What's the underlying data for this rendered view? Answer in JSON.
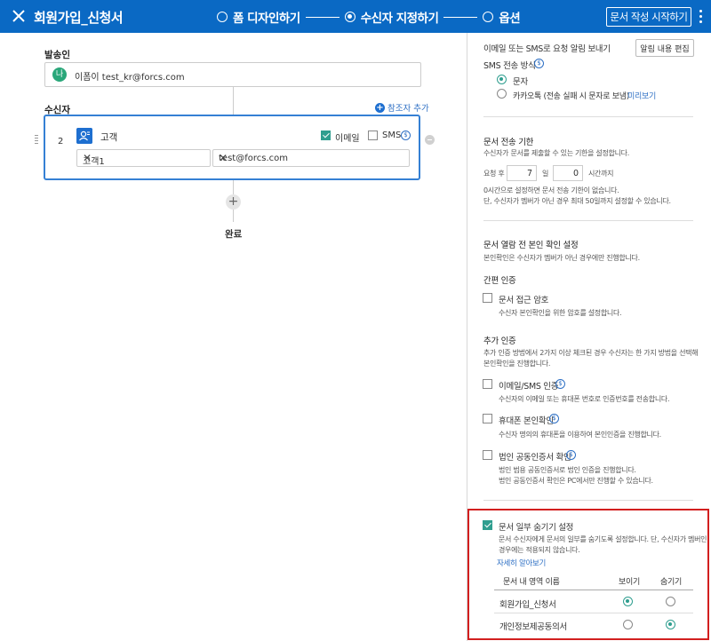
{
  "header": {
    "title": "회원가입_신청서",
    "steps": [
      "폼 디자인하기",
      "수신자 지정하기",
      "옵션"
    ],
    "active_step": 1,
    "start_button": "문서 작성 시작하기"
  },
  "sender": {
    "label": "발송인",
    "avatar": "나",
    "name": "이폼이 test_kr@forcs.com"
  },
  "recipients": {
    "label": "수신자",
    "add_ref": "참조자 추가",
    "items": [
      {
        "number": "2",
        "name": "고객",
        "email_checked": true,
        "email_label": "이메일",
        "sms_checked": false,
        "sms_label": "SMS",
        "name_value": "고객1",
        "email_value": "test@forcs.com"
      }
    ],
    "done": "완료"
  },
  "options": {
    "notify_text": "이메일 또는 SMS로 요청 알림 보내기",
    "edit_notify_button": "알림 내용 편집",
    "sms_method_label": "SMS 전송 방식",
    "sms_methods": [
      "문자",
      "카카오톡 (전송 실패 시 문자로 보냄)"
    ],
    "sms_selected": 0,
    "preview_link": "미리보기",
    "deadline": {
      "title": "문서 전송 기한",
      "desc": "수신자가 문서를 제출할 수 있는 기한을 설정합니다.",
      "prefix": "요청 후",
      "days": "7",
      "day_unit": "일",
      "hours": "0",
      "hour_unit": "시간까지",
      "note1": "0시간으로 설정하면 문서 전송 기한이 없습니다.",
      "note2": "단, 수신자가 멤버가 아닌 경우 최대 50일까지 설정할 수 있습니다."
    },
    "verification": {
      "title": "문서 열람 전 본인 확인 설정",
      "desc": "본인확인은 수신자가 멤버가 아닌 경우에만 진행합니다.",
      "simple_title": "간편 인증",
      "access_pw_label": "문서 접근 암호",
      "access_pw_desc": "수신자 본인확인을 위한 암호를 설정합니다.",
      "extra_title": "추가 인증",
      "extra_desc1": "추가 인증 방법에서 2가지 이상 체크된 경우 수신자는 한 가지 방법을 선택해",
      "extra_desc2": "본인확인을 진행합니다.",
      "email_sms_label": "이메일/SMS 인증",
      "email_sms_desc": "수신자의 이메일 또는 휴대폰 번호로 인증번호를 전송합니다.",
      "phone_label": "휴대폰 본인확인",
      "phone_desc": "수신자 명의의 휴대폰을 이용하여 본인인증을 진행합니다.",
      "cert_label": "법인 공동인증서 확인",
      "cert_desc1": "법인 범용 공동인증서로 법인 인증을 진행합니다.",
      "cert_desc2": "법인 공동인증서 확인은 PC에서만 진행할 수 있습니다."
    },
    "hide": {
      "checked": true,
      "label": "문서 일부 숨기기 설정",
      "desc1": "문서 수신자에게 문서의 일부를 숨기도록 설정합니다. 단, 수신자가 멤버인",
      "desc2": "경우에는 적용되지 않습니다.",
      "more_link": "자세히 알아보기",
      "col_name": "문서 내 영역 이름",
      "col_show": "보이기",
      "col_hide": "숨기기",
      "rows": [
        {
          "name": "회원가입_신청서",
          "selected": "show"
        },
        {
          "name": "개인정보제공동의서",
          "selected": "hide"
        }
      ]
    }
  },
  "colors": {
    "header_bg": "#0a69c4",
    "accent": "#2f9e8f",
    "link": "#2d6fc4",
    "highlight_border": "#d21f1f"
  }
}
